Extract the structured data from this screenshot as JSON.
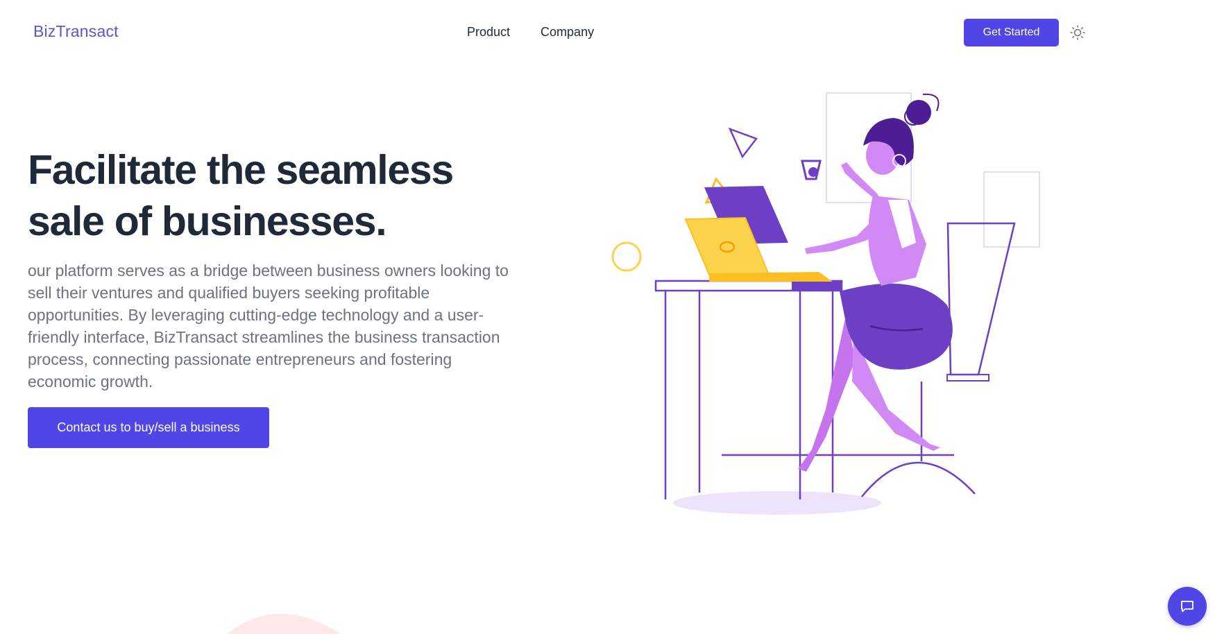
{
  "header": {
    "logo": "BizTransact",
    "nav": [
      {
        "label": "Product"
      },
      {
        "label": "Company"
      }
    ],
    "cta_label": "Get Started",
    "theme_toggle_icon": "sun-icon"
  },
  "hero": {
    "title_line1": "Facilitate the seamless",
    "title_line2": "sale of businesses.",
    "description": "our platform serves as a bridge between business owners looking to sell their ventures and qualified buyers seeking profitable opportunities. By leveraging cutting-edge technology and a user-friendly interface, BizTransact streamlines the business transaction process, connecting passionate entrepreneurs and fostering economic growth.",
    "cta_label": "Contact us to buy/sell a business"
  },
  "chat": {
    "icon": "chat-bubble-icon"
  },
  "colors": {
    "accent": "#4f46e5",
    "logo": "#5a55d6",
    "heading": "#1f2937",
    "body_text": "#6b7280",
    "illustration_purple": "#6d3fc4",
    "illustration_pink": "#d18af5",
    "illustration_yellow": "#fbbf24"
  }
}
